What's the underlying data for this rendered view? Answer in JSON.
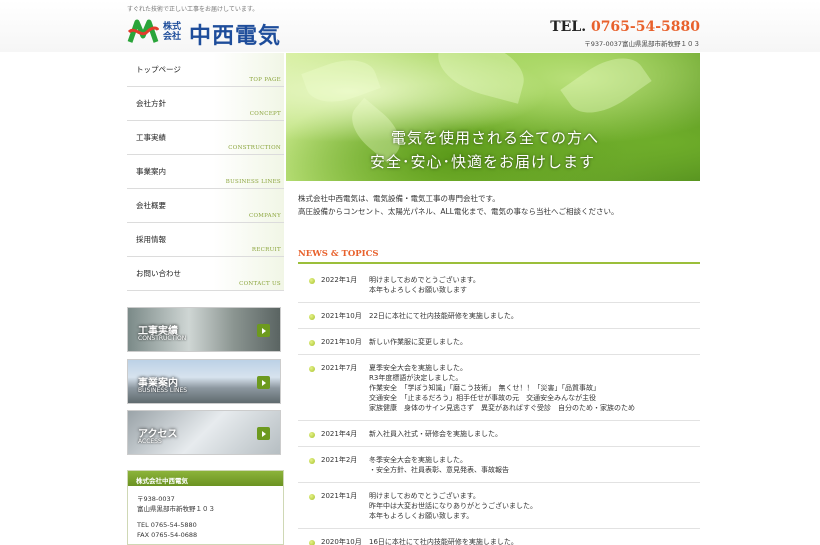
{
  "header": {
    "tagline": "すぐれた技術で正しい工事をお届けしています。",
    "logo_prefix": "株式会社",
    "logo_name": "中西電気",
    "tel_label": "TEL.",
    "tel_number": "0765-54-5880",
    "address": "〒937-0037富山県黒部市新牧野１０３"
  },
  "nav": [
    {
      "jp": "トップページ",
      "en": "TOP PAGE"
    },
    {
      "jp": "会社方針",
      "en": "CONCEPT"
    },
    {
      "jp": "工事実績",
      "en": "CONSTRUCTION"
    },
    {
      "jp": "事業案内",
      "en": "BUSINESS LINES"
    },
    {
      "jp": "会社概要",
      "en": "COMPANY"
    },
    {
      "jp": "採用情報",
      "en": "RECRUIT"
    },
    {
      "jp": "お問い合わせ",
      "en": "CONTACT US"
    }
  ],
  "banners": [
    {
      "label": "工事実績",
      "sub": "CONSTRUCTION"
    },
    {
      "label": "事業案内",
      "sub": "BUSINESS LINES"
    },
    {
      "label": "アクセス",
      "sub": "ACCESS"
    }
  ],
  "company_box": {
    "title": "株式会社中西電気",
    "postal": "〒938-0037",
    "address": "富山県黒部市新牧野１０３",
    "tel": "TEL 0765-54-5880",
    "fax": "FAX 0765-54-0688"
  },
  "hero": {
    "line1": "電気を使用される全ての方へ",
    "line2": "安全･安心･快適をお届けします"
  },
  "intro": {
    "line1": "株式会社中西電気は、電気設備・電気工事の専門会社です。",
    "line2": "高圧設備からコンセント、太陽光パネル、ALL電化まで、電気の事なら当社へご相談ください。"
  },
  "news": {
    "title": "NEWS & TOPICS",
    "items": [
      {
        "date": "2022年1月",
        "text": "明けましておめでとうございます。\n本年もよろしくお願い致します"
      },
      {
        "date": "2021年10月",
        "text": "22日に本社にて社内技能研修を実施しました。"
      },
      {
        "date": "2021年10月",
        "text": "新しい作業服に変更しました。"
      },
      {
        "date": "2021年7月",
        "text": "夏季安全大会を実施しました。\nR3年度標語が決定しました。\n作業安全　「学ぼう知識」「磨こう技術」　無くせ！！「災害」「品質事故」\n交通安全　「止まるだろう」相手任せが事故の元　交通安全みんなが主役\n家族健康　身体のサイン見逃さず　異変があればすぐ受診　自分のため・家族のため"
      },
      {
        "date": "2021年4月",
        "text": "新入社員入社式・研修会を実施しました。"
      },
      {
        "date": "2021年2月",
        "text": "冬季安全大会を実施しました。\n・安全方針、社員表彰、意見発表、事故報告"
      },
      {
        "date": "2021年1月",
        "text": "明けましておめでとうございます。\n昨年中は大変お世話になりありがとうございました。\n本年もよろしくお願い致します。"
      },
      {
        "date": "2020年10月",
        "text": "16日に本社にて社内技能研修を実施しました。"
      }
    ]
  },
  "colors": {
    "brand_blue": "#1e4d9b",
    "accent_green": "#8cb33a",
    "news_orange": "#e8612c"
  }
}
